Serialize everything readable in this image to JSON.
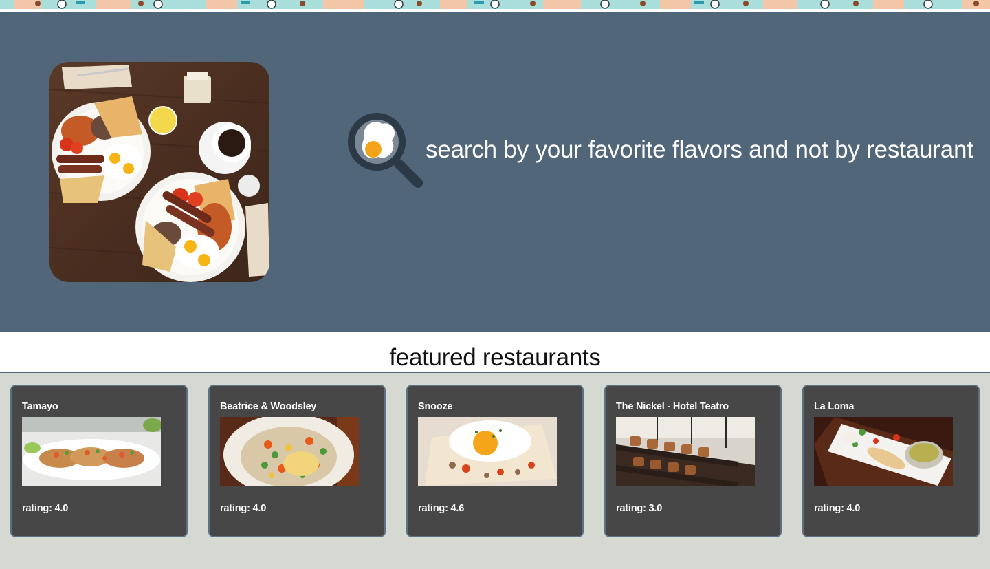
{
  "hero": {
    "photo_name": "breakfast-photo",
    "tagline": "search by your favorite flavors and not by restaurant",
    "icon": "search-egg-icon"
  },
  "featured": {
    "title": "featured restaurants"
  },
  "restaurants": [
    {
      "name": "Tamayo",
      "rating": "rating: 4.0"
    },
    {
      "name": "Beatrice & Woodsley",
      "rating": "rating: 4.0"
    },
    {
      "name": "Snooze",
      "rating": "rating: 4.6"
    },
    {
      "name": "The Nickel - Hotel Teatro",
      "rating": "rating: 3.0"
    },
    {
      "name": "La Loma",
      "rating": "rating: 4.0"
    }
  ],
  "colors": {
    "hero_bg": "#516679",
    "card_bg": "#474747",
    "page_bg": "#d6d8d2"
  }
}
